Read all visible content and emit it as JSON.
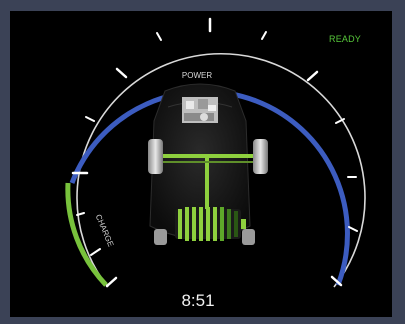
{
  "status": {
    "ready_label": "READY"
  },
  "gauge": {
    "power_label": "POWER",
    "charge_label": "CHARGE",
    "charge_level": 0.28
  },
  "clock": {
    "time": "8:51"
  },
  "colors": {
    "power_arc": "#3c5cc0",
    "charge_arc": "#78c23c",
    "ready": "#57c73a",
    "flow": "#8ed03e"
  }
}
